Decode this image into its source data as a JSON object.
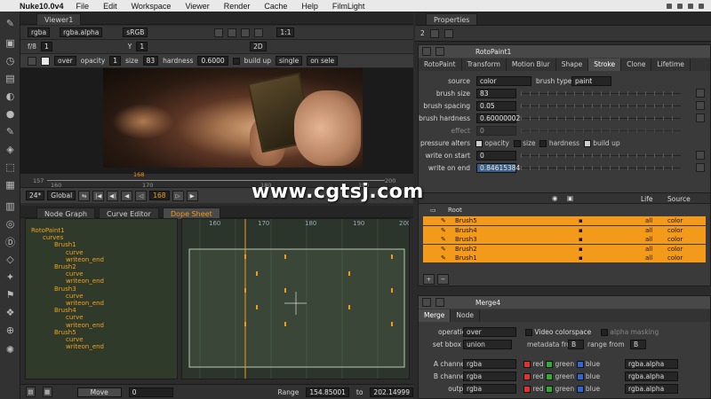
{
  "menubar": {
    "app_name": "Nuke10.0v4",
    "items": [
      "File",
      "Edit",
      "Workspace",
      "Viewer",
      "Render",
      "Cache",
      "Help",
      "FilmLight"
    ]
  },
  "viewer": {
    "tab": "Viewer1",
    "channels": "rgba",
    "layer": "rgba.alpha",
    "colorspace": "sRGB",
    "zoom": "1:1",
    "mode_2d": "2D",
    "fstop": "f/8",
    "gamma": "1",
    "y_value": "1"
  },
  "paint_toolbar": {
    "blend": "over",
    "opacity_label": "opacity",
    "opacity": "1",
    "size_label": "size",
    "size": "83",
    "hardness_label": "hardness",
    "hardness": "0.6000",
    "buildup_label": "build up",
    "stroke_mode": "single",
    "on_mode": "on sele"
  },
  "timeline": {
    "start": "157",
    "ticks": [
      "160",
      "170",
      "180",
      "190",
      "200"
    ],
    "current_marker": "168",
    "end": "200",
    "fps": "24*",
    "scope": "Global",
    "current_frame": "168",
    "step": "10",
    "playhead_fraction": 0.28
  },
  "bottom_left": {
    "tabs": [
      "Node Graph",
      "Curve Editor",
      "Dope Sheet"
    ],
    "active_tab": "Dope Sheet",
    "tree": [
      {
        "label": "RotoPaint1",
        "depth": 0
      },
      {
        "label": "curves",
        "depth": 1
      },
      {
        "label": "Brush1",
        "depth": 2
      },
      {
        "label": "curve",
        "depth": 3
      },
      {
        "label": "writeon_end",
        "depth": 3
      },
      {
        "label": "Brush2",
        "depth": 2
      },
      {
        "label": "curve",
        "depth": 3
      },
      {
        "label": "writeon_end",
        "depth": 3
      },
      {
        "label": "Brush3",
        "depth": 2
      },
      {
        "label": "curve",
        "depth": 3
      },
      {
        "label": "writeon_end",
        "depth": 3
      },
      {
        "label": "Brush4",
        "depth": 2
      },
      {
        "label": "curve",
        "depth": 3
      },
      {
        "label": "writeon_end",
        "depth": 3
      },
      {
        "label": "Brush5",
        "depth": 2
      },
      {
        "label": "curve",
        "depth": 3
      },
      {
        "label": "writeon_end",
        "depth": 3
      }
    ],
    "grid_ticks": [
      "160",
      "170",
      "180",
      "190",
      "200"
    ],
    "move_label": "Move",
    "move_value": "0",
    "range_label": "Range",
    "range_start": "154.85001",
    "range_to": "to",
    "range_end": "202.14999"
  },
  "properties": {
    "title": "Properties",
    "count": "2",
    "node1": {
      "name": "RotoPaint1",
      "tabs": [
        "RotoPaint",
        "Transform",
        "Motion Blur",
        "Shape",
        "Stroke",
        "Clone",
        "Lifetime"
      ],
      "active_tab": "Stroke",
      "source_label": "source",
      "source": "color",
      "brush_type_label": "brush type",
      "brush_type": "paint",
      "brush_size_label": "brush size",
      "brush_size": "83",
      "brush_spacing_label": "brush spacing",
      "brush_spacing": "0.05",
      "brush_hardness_label": "brush hardness",
      "brush_hardness": "0.60000002",
      "effect_label": "effect",
      "effect": "0",
      "pressure_label": "pressure alters",
      "pressure_opts": [
        "opacity",
        "size",
        "hardness",
        "build up"
      ],
      "write_on_start_label": "write on start",
      "write_on_start": "0",
      "write_on_end_label": "write on end",
      "write_on_end": "0.84615384",
      "layers_cols": [
        "Life",
        "Source"
      ],
      "root_label": "Root",
      "layers": [
        {
          "name": "Brush5",
          "life": "all",
          "source": "color"
        },
        {
          "name": "Brush4",
          "life": "all",
          "source": "color"
        },
        {
          "name": "Brush3",
          "life": "all",
          "source": "color"
        },
        {
          "name": "Brush2",
          "life": "all",
          "source": "color"
        },
        {
          "name": "Brush1",
          "life": "all",
          "source": "color"
        }
      ]
    },
    "node2": {
      "name": "Merge4",
      "tabs": [
        "Merge",
        "Node"
      ],
      "operation_label": "operation",
      "operation": "over",
      "video_colorspace": "Video colorspace",
      "alpha_masking": "alpha masking",
      "bbox_label": "set bbox to",
      "bbox": "union",
      "metadata_label": "metadata from",
      "metadata": "B",
      "range_label": "range from",
      "range": "B",
      "a_label": "A channels",
      "b_label": "B channels",
      "out_label": "output",
      "channels": "rgba",
      "red": "red",
      "green": "green",
      "blue": "blue",
      "alpha": "rgba.alpha"
    }
  },
  "watermark": "www.cgtsj.com",
  "colors": {
    "accent_orange": "#f39a1a",
    "panel": "#3a3a3a",
    "dark": "#262626"
  }
}
